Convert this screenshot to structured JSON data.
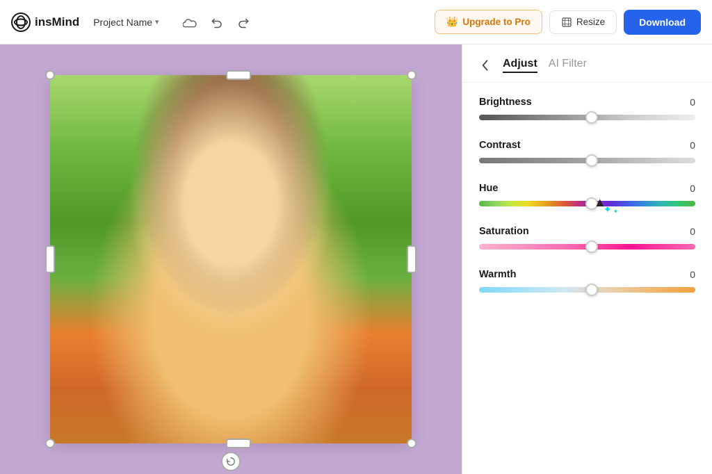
{
  "app": {
    "logo_text": "insMind",
    "project_name": "Project Name"
  },
  "header": {
    "upgrade_label": "Upgrade to Pro",
    "resize_label": "Resize",
    "download_label": "Download"
  },
  "panel": {
    "back_label": "‹",
    "tab_adjust": "Adjust",
    "tab_ai_filter": "AI Filter"
  },
  "sliders": [
    {
      "id": "brightness",
      "label": "Brightness",
      "value": 0,
      "position_pct": 52
    },
    {
      "id": "contrast",
      "label": "Contrast",
      "value": 0,
      "position_pct": 52
    },
    {
      "id": "hue",
      "label": "Hue",
      "value": 0,
      "position_pct": 52
    },
    {
      "id": "saturation",
      "label": "Saturation",
      "value": 0,
      "position_pct": 52
    },
    {
      "id": "warmth",
      "label": "Warmth",
      "value": 0,
      "position_pct": 52
    }
  ]
}
